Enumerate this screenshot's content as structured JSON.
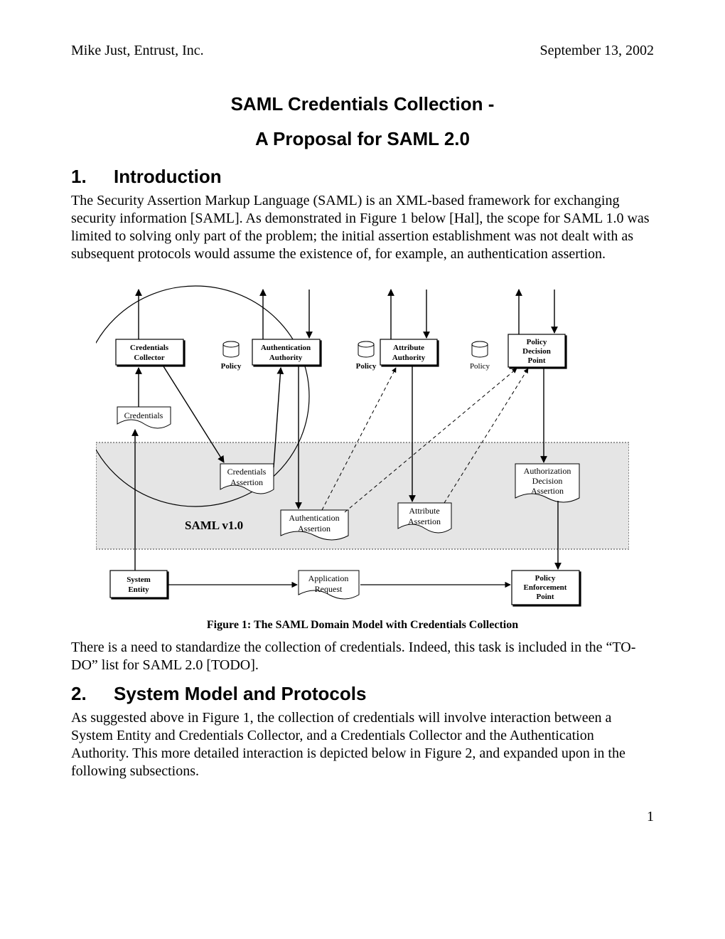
{
  "header": {
    "left": "Mike Just, Entrust, Inc.",
    "right": "September 13, 2002"
  },
  "title": {
    "line1": "SAML Credentials Collection -",
    "line2": "A Proposal for SAML 2.0"
  },
  "sections": {
    "s1": {
      "num": "1.",
      "title": "Introduction",
      "p1": "The Security Assertion Markup Language (SAML) is an XML-based framework for exchanging security information [SAML].  As demonstrated in Figure 1 below [Hal], the scope for SAML 1.0 was limited to solving only part of the problem; the initial assertion establishment was not dealt with as subsequent protocols would assume the existence of, for example, an authentication assertion.",
      "p2": "There is a need to standardize the collection of credentials.  Indeed, this task is included in the “TO-DO” list for SAML 2.0 [TODO]."
    },
    "s2": {
      "num": "2.",
      "title": "System Model and Protocols",
      "p1": "As suggested above in Figure 1, the collection of credentials will involve interaction between a System Entity and Credentials Collector, and a Credentials Collector and the Authentication Authority.  This more detailed interaction is depicted below in Figure 2, and expanded upon in the following subsections."
    }
  },
  "figure": {
    "caption": "Figure 1: The SAML Domain Model with Credentials Collection",
    "labels": {
      "credCollector1": "Credentials",
      "credCollector2": "Collector",
      "authAuthority1": "Authentication",
      "authAuthority2": "Authority",
      "attrAuthority1": "Attribute",
      "attrAuthority2": "Authority",
      "pdp1": "Policy",
      "pdp2": "Decision",
      "pdp3": "Point",
      "policy": "Policy",
      "credentials": "Credentials",
      "credAssert1": "Credentials",
      "credAssert2": "Assertion",
      "authAssert1": "Authentication",
      "authAssert2": "Assertion",
      "attrAssert1": "Attribute",
      "attrAssert2": "Assertion",
      "authzAssert1": "Authorization",
      "authzAssert2": "Decision",
      "authzAssert3": "Assertion",
      "samlv10": "SAML v1.0",
      "sysEntity1": "System",
      "sysEntity2": "Entity",
      "appReq1": "Application",
      "appReq2": "Request",
      "pep1": "Policy",
      "pep2": "Enforcement",
      "pep3": "Point"
    }
  },
  "pageNumber": "1"
}
